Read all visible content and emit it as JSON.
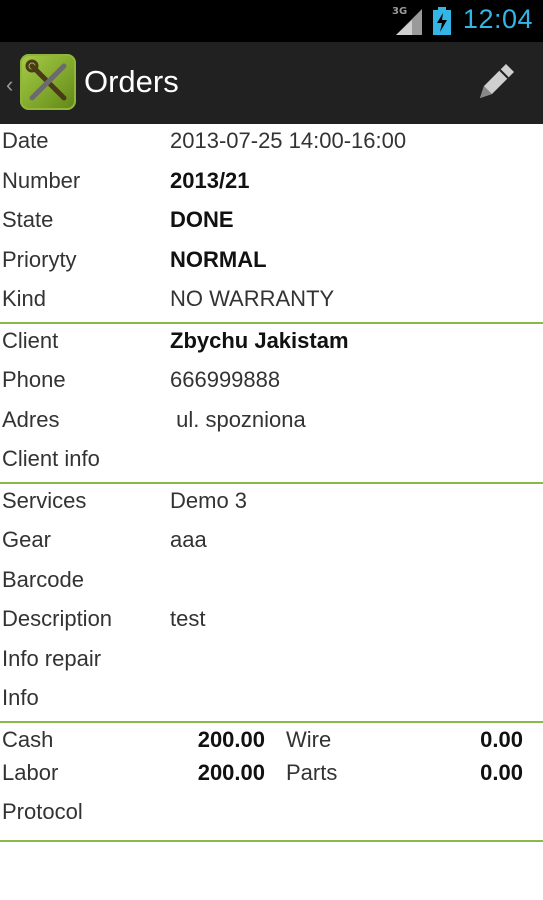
{
  "status_bar": {
    "network": "3G",
    "time": "12:04",
    "icons": [
      "signal-icon",
      "battery-charging-icon"
    ]
  },
  "action_bar": {
    "up_icon": "chevron-left-icon",
    "app_icon": "wrench-screwdriver-icon",
    "title": "Orders",
    "action_icon": "pencil-icon",
    "accent": "#8bb84a",
    "time_color": "#33b5e5"
  },
  "order": {
    "section1": [
      {
        "label": "Date",
        "value": "2013-07-25 14:00-16:00",
        "bold": false
      },
      {
        "label": "Number",
        "value": "2013/21",
        "bold": true
      },
      {
        "label": "State",
        "value": "DONE",
        "bold": true
      },
      {
        "label": "Prioryty",
        "value": "NORMAL",
        "bold": true
      },
      {
        "label": "Kind",
        "value": "NO WARRANTY",
        "bold": false
      }
    ],
    "section2": [
      {
        "label": "Client",
        "value": "Zbychu Jakistam",
        "bold": true
      },
      {
        "label": "Phone",
        "value": "666999888",
        "bold": false
      },
      {
        "label": "Adres",
        "value": " ul. spozniona",
        "bold": false
      },
      {
        "label": "Client info",
        "value": "",
        "bold": false
      }
    ],
    "section3": [
      {
        "label": "Services",
        "value": "Demo 3",
        "bold": false
      },
      {
        "label": "Gear",
        "value": "aaa",
        "bold": false
      },
      {
        "label": "Barcode",
        "value": "",
        "bold": false
      },
      {
        "label": "Description",
        "value": "test",
        "bold": false
      },
      {
        "label": "Info repair",
        "value": "",
        "bold": false
      },
      {
        "label": "Info",
        "value": "",
        "bold": false
      }
    ],
    "money": {
      "cash_label": "Cash",
      "cash_value": "200.00",
      "wire_label": "Wire",
      "wire_value": "0.00",
      "labor_label": "Labor",
      "labor_value": "200.00",
      "parts_label": "Parts",
      "parts_value": "0.00",
      "protocol_label": "Protocol",
      "protocol_value": ""
    }
  }
}
